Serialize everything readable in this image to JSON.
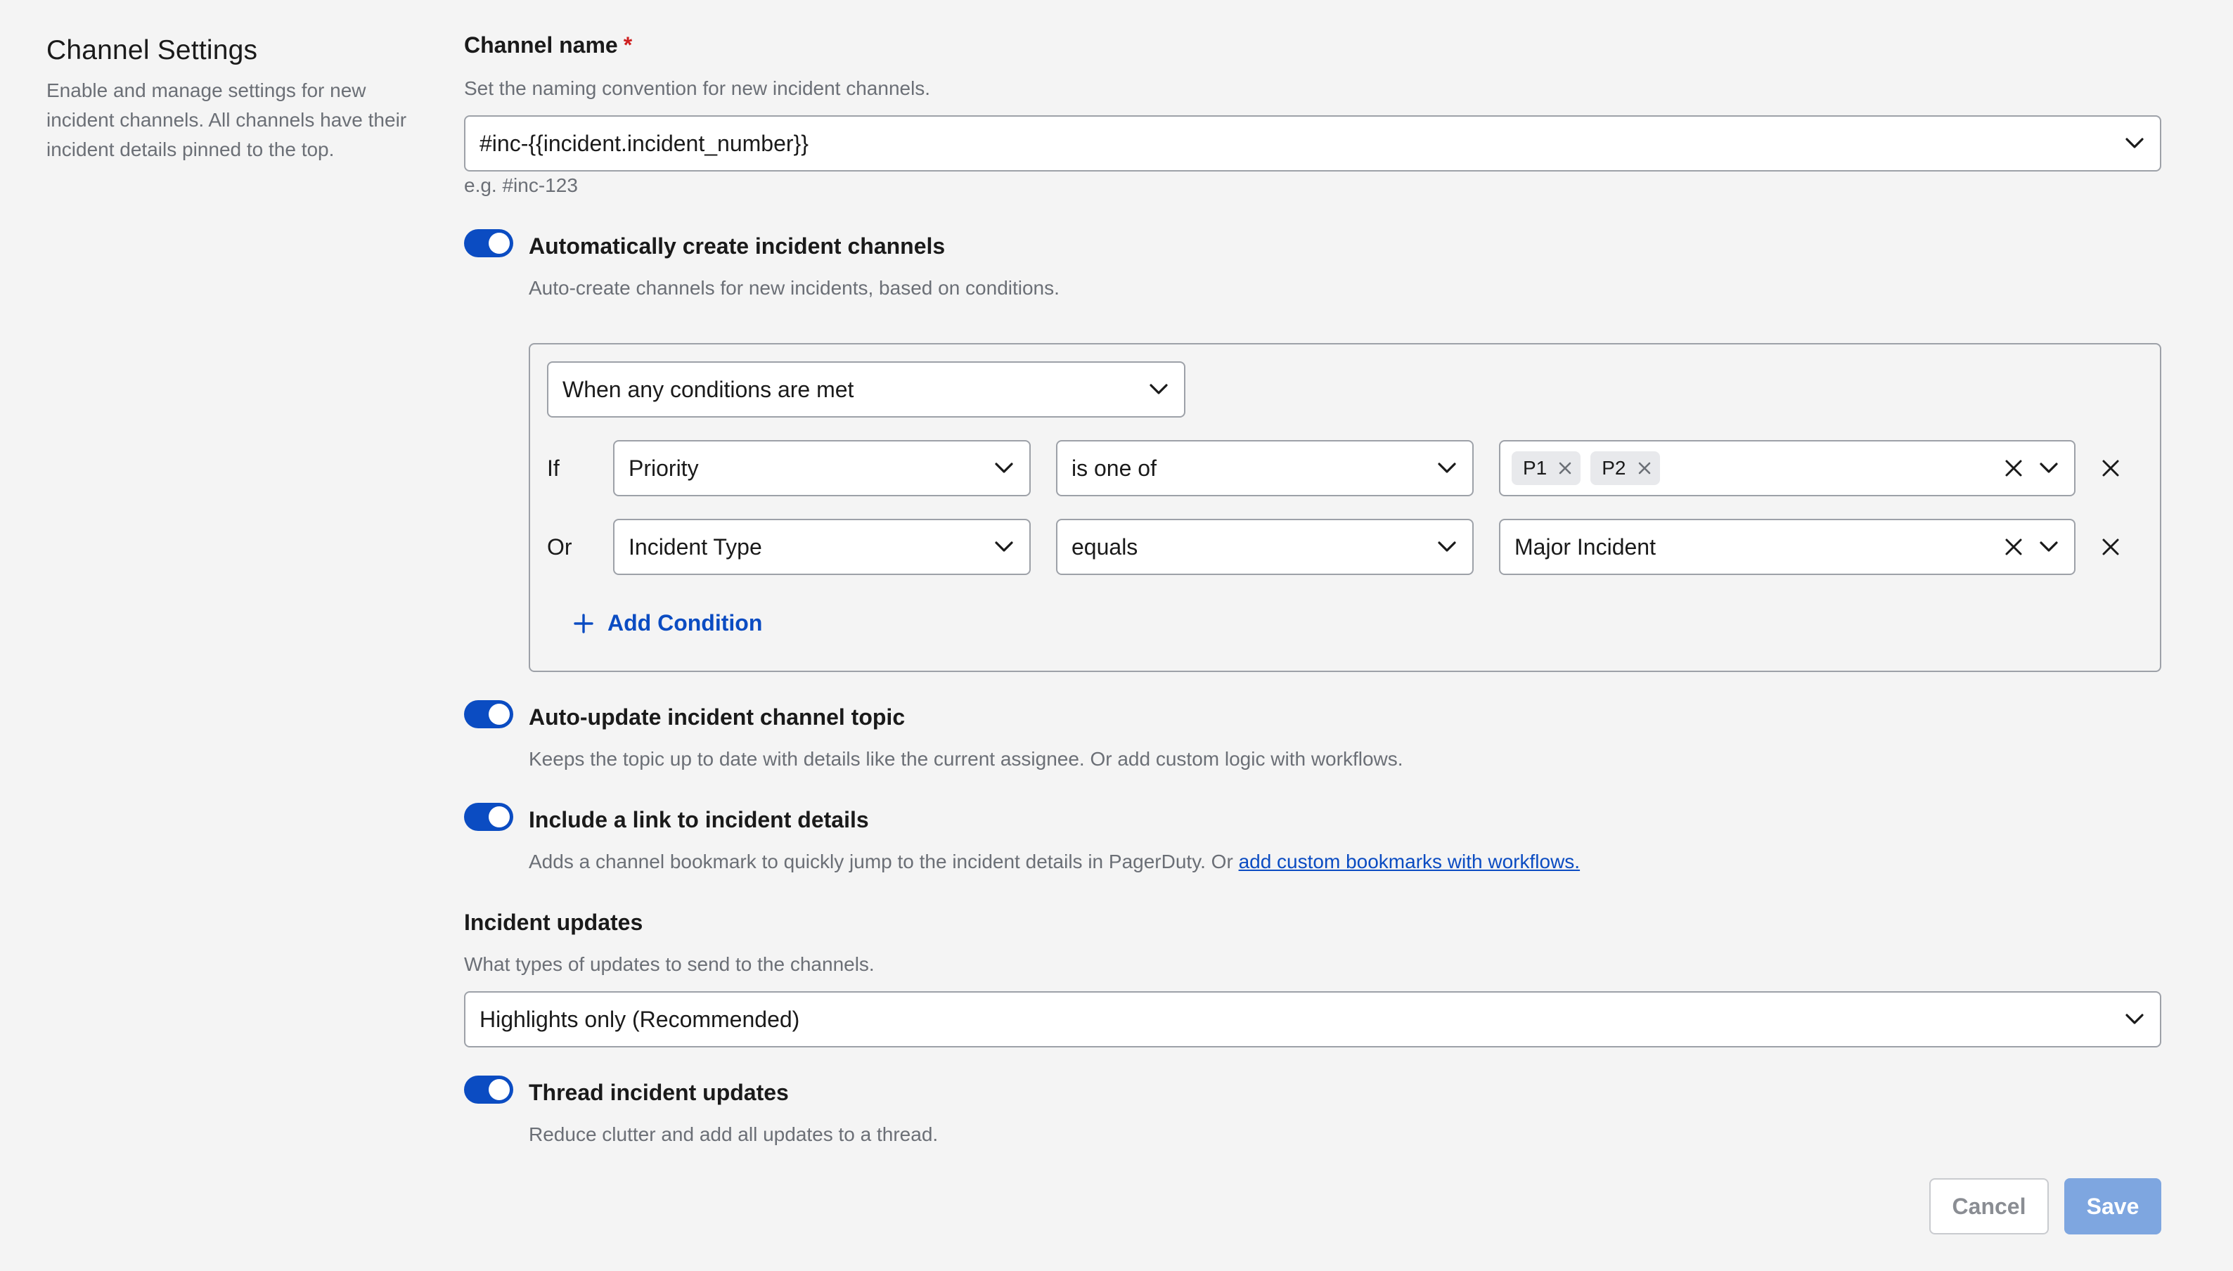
{
  "sidebar": {
    "title": "Channel Settings",
    "description": "Enable and manage settings for new incident channels. All channels have their incident details pinned to the top."
  },
  "channel_name": {
    "label": "Channel name",
    "required_mark": "*",
    "help": "Set the naming convention for new incident channels.",
    "value": "#inc-{{incident.incident_number}}",
    "example": "e.g. #inc-123"
  },
  "auto_create": {
    "enabled": true,
    "label": "Automatically create incident channels",
    "help": "Auto-create channels for new incidents, based on conditions.",
    "match_mode": "When any conditions are met",
    "conditions": [
      {
        "connector": "If",
        "field": "Priority",
        "operator": "is one of",
        "values": [
          "P1",
          "P2"
        ]
      },
      {
        "connector": "Or",
        "field": "Incident Type",
        "operator": "equals",
        "value": "Major Incident"
      }
    ],
    "add_condition_label": "Add Condition"
  },
  "auto_topic": {
    "enabled": true,
    "label": "Auto-update incident channel topic",
    "help": "Keeps the topic up to date with details like the current assignee. Or add custom logic with workflows."
  },
  "include_link": {
    "enabled": true,
    "label": "Include a link to incident details",
    "help": "Adds a channel bookmark to quickly jump to the incident details in PagerDuty. Or",
    "help_link": "add custom bookmarks with workflows."
  },
  "incident_updates": {
    "label": "Incident updates",
    "help": "What types of updates to send to the channels.",
    "value": "Highlights only (Recommended)"
  },
  "thread_updates": {
    "enabled": true,
    "label": "Thread incident updates",
    "help": "Reduce clutter and add all updates to a thread."
  },
  "actions": {
    "cancel_label": "Cancel",
    "save_label": "Save"
  },
  "colors": {
    "accent": "#0b4cc2",
    "save_disabled": "#7ea6e0",
    "required": "#cf1f1f"
  }
}
